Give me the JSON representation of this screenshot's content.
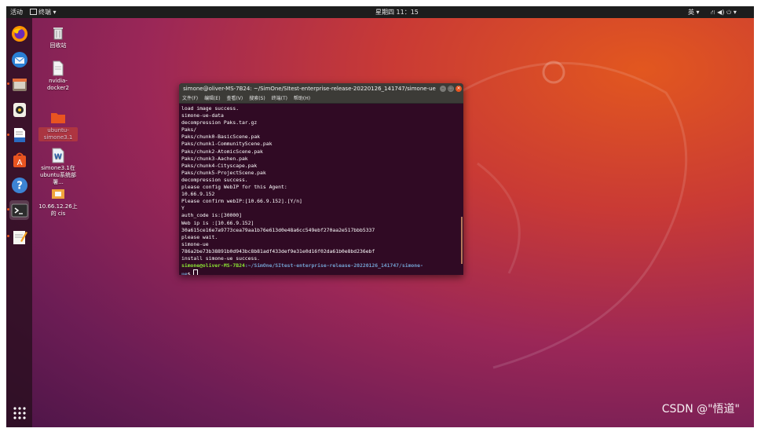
{
  "topbar": {
    "activities": "活动",
    "app_menu": "终端 ▾",
    "clock": "星期四 11：15",
    "input_method": "英 ▾",
    "system_icons": "⛙ ◀) ⏻ ▾"
  },
  "dock": {
    "items": [
      {
        "name": "firefox-icon"
      },
      {
        "name": "thunderbird-icon"
      },
      {
        "name": "files-icon"
      },
      {
        "name": "rhythmbox-icon"
      },
      {
        "name": "libreoffice-writer-icon"
      },
      {
        "name": "ubuntu-software-icon"
      },
      {
        "name": "help-icon"
      },
      {
        "name": "terminal-icon"
      },
      {
        "name": "text-editor-icon"
      }
    ],
    "show_apps_icon": "show-applications-icon"
  },
  "desktop": {
    "icons": [
      {
        "label": "回收站"
      },
      {
        "label": "nvidia-docker2"
      },
      {
        "label": "ubuntu-simone3.1"
      },
      {
        "label": "simone3.1在ubuntu系统部署..."
      },
      {
        "label": "10.66.12.26上的 cis"
      }
    ]
  },
  "terminal": {
    "title": "simone@oliver-MS-7B24: ~/SimOne/SItest-enterprise-release-20220126_141747/simone-ue",
    "menu": [
      "文件(F)",
      "编辑(E)",
      "查看(V)",
      "搜索(S)",
      "终端(T)",
      "帮助(H)"
    ],
    "lines": [
      "load image success.",
      "simone-ue-data",
      "decompression Paks.tar.gz",
      "Paks/",
      "Paks/chunk0-BasicScene.pak",
      "Paks/chunk1-CommunityScene.pak",
      "Paks/chunk2-AtomicScene.pak",
      "Paks/chunk3-Aachen.pak",
      "Paks/chunk4-Cityscape.pak",
      "Paks/chunk5-ProjectScene.pak",
      "decompression success.",
      "please config WebIP for this Agent:",
      "10.66.9.152",
      "Please confirm webIP:[10.66.9.152].[Y/n]",
      "Y",
      "auth_code is:[30000]",
      "Web ip is :[10.66.9.152]",
      "30a615ce16e7a9773cea79aa1b76e613d0e48a6cc549ebf270aa2e517bbb5337",
      "please wait.",
      "simone-ue",
      "786a2be73b38891b0d943bc8b81adf433def9e31e0d16f02da61b0e8bd236ebf",
      "install simone-ue success."
    ],
    "prompt_user": "simone@oliver-MS-7B24",
    "prompt_path": ":~/SimOne/SItest-enterprise-release-20220126_141747/simone-",
    "prompt_path2": "ue",
    "prompt_symbol": "$ "
  },
  "watermark": "CSDN @\"悟道\""
}
